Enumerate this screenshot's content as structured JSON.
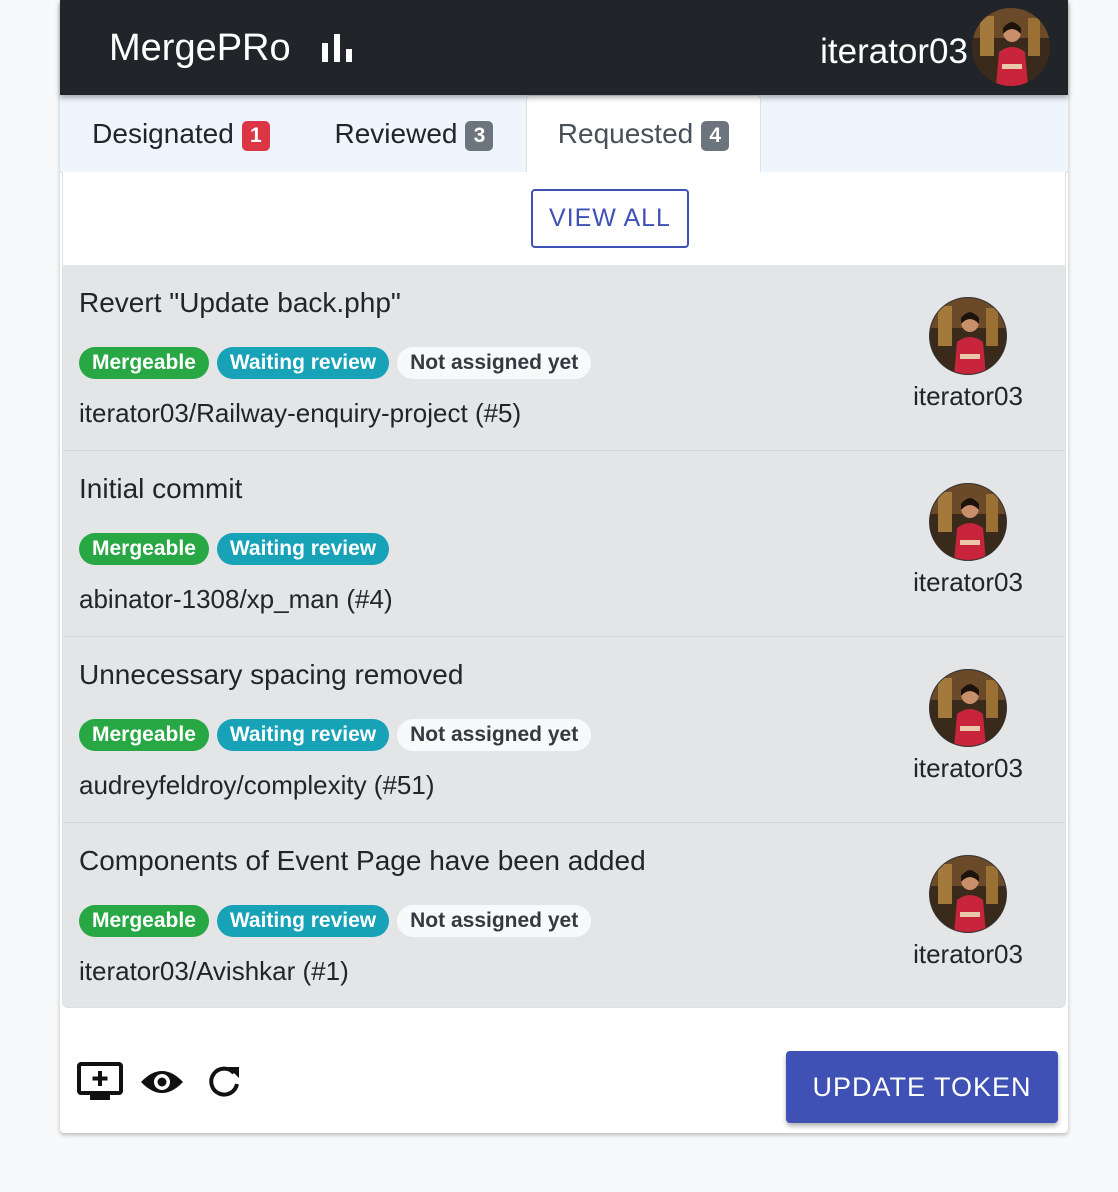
{
  "header": {
    "brand": "MergePRo",
    "brand_icon": "bar-chart-icon",
    "user": "iterator03"
  },
  "tabs": [
    {
      "label": "Designated",
      "count": "1",
      "badge_color": "#dc3545"
    },
    {
      "label": "Reviewed",
      "count": "3",
      "badge_color": "#6c757d"
    },
    {
      "label": "Requested",
      "count": "4",
      "badge_color": "#6c757d",
      "active": true
    }
  ],
  "panel": {
    "view_all": "VIEW ALL"
  },
  "pull_requests": [
    {
      "title": "Revert \"Update back.php\"",
      "tags": [
        "Mergeable",
        "Waiting review",
        "Not assigned yet"
      ],
      "repo": "iterator03/Railway-enquiry-project (#5)",
      "author": "iterator03"
    },
    {
      "title": "Initial commit",
      "tags": [
        "Mergeable",
        "Waiting review"
      ],
      "repo": "abinator-1308/xp_man (#4)",
      "author": "iterator03"
    },
    {
      "title": "Unnecessary spacing removed",
      "tags": [
        "Mergeable",
        "Waiting review",
        "Not assigned yet"
      ],
      "repo": "audreyfeldroy/complexity (#51)",
      "author": "iterator03"
    },
    {
      "title": "Components of Event Page have been added",
      "tags": [
        "Mergeable",
        "Waiting review",
        "Not assigned yet"
      ],
      "repo": "iterator03/Avishkar (#1)",
      "author": "iterator03"
    }
  ],
  "footer": {
    "icons": [
      "add-to-screen-icon",
      "eye-icon",
      "refresh-icon"
    ],
    "update_token": "UPDATE TOKEN"
  },
  "colors": {
    "navbar": "#212529",
    "accent": "#3f51b5",
    "mergeable": "#28a745",
    "waiting": "#17a2b8"
  }
}
